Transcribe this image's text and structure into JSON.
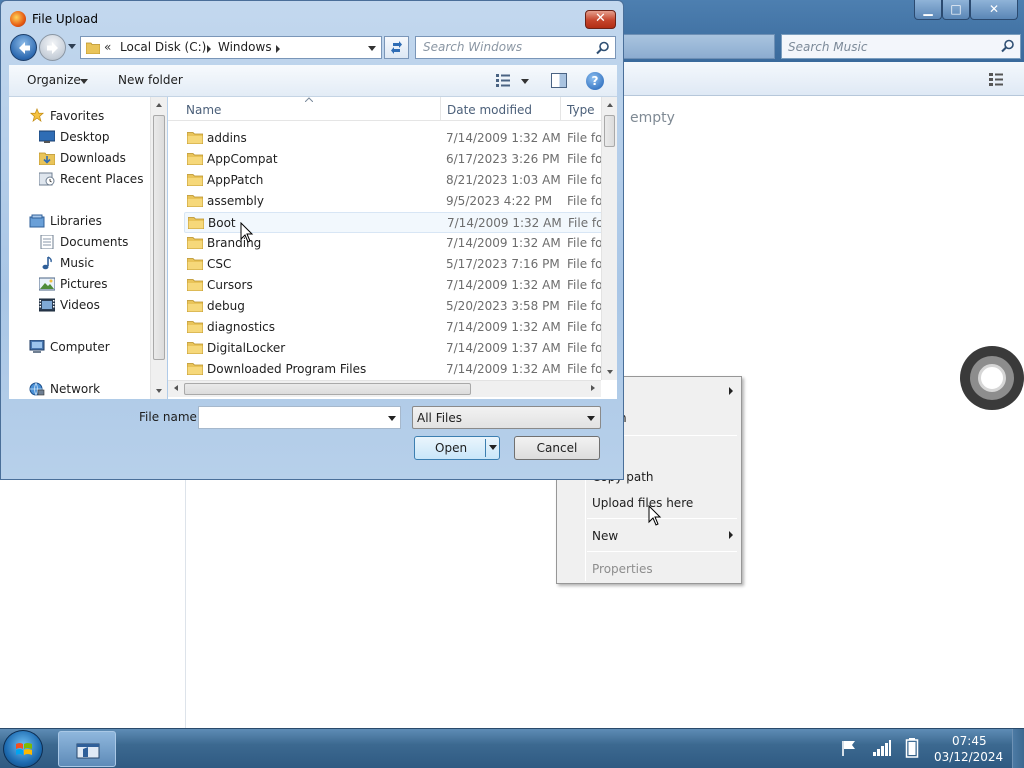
{
  "background_window": {
    "search_placeholder": "Search Music",
    "empty_message": "empty",
    "controls": {
      "minimize": "▁",
      "maximize": "□",
      "close": "✕"
    }
  },
  "context_menu": {
    "items": [
      {
        "label": "",
        "has_submenu": true,
        "enabled": true
      },
      {
        "label": "h",
        "has_submenu": false,
        "enabled": true
      },
      {
        "label": "Copy path",
        "has_submenu": false,
        "enabled": true
      },
      {
        "label": "Upload files here",
        "has_submenu": false,
        "enabled": true
      },
      {
        "label": "New",
        "has_submenu": true,
        "enabled": true
      },
      {
        "label": "Properties",
        "has_submenu": false,
        "enabled": false
      }
    ]
  },
  "dialog": {
    "title": "File Upload",
    "close_label": "✕",
    "address": {
      "chevron": "«",
      "segments": [
        "Local Disk (C:)",
        "Windows"
      ]
    },
    "search_placeholder": "Search Windows",
    "toolbar": {
      "organize": "Organize",
      "new_folder": "New folder",
      "help": "?"
    },
    "nav_pane": {
      "favorites": {
        "label": "Favorites",
        "items": [
          "Desktop",
          "Downloads",
          "Recent Places"
        ]
      },
      "libraries": {
        "label": "Libraries",
        "items": [
          "Documents",
          "Music",
          "Pictures",
          "Videos"
        ]
      },
      "computer": "Computer",
      "network": "Network"
    },
    "columns": {
      "name": "Name",
      "date": "Date modified",
      "type": "Type"
    },
    "files": [
      {
        "name": "addins",
        "date": "7/14/2009 1:32 AM",
        "type": "File folder"
      },
      {
        "name": "AppCompat",
        "date": "6/17/2023 3:26 PM",
        "type": "File folder"
      },
      {
        "name": "AppPatch",
        "date": "8/21/2023 1:03 AM",
        "type": "File folder"
      },
      {
        "name": "assembly",
        "date": "9/5/2023 4:22 PM",
        "type": "File folder"
      },
      {
        "name": "Boot",
        "date": "7/14/2009 1:32 AM",
        "type": "File folder"
      },
      {
        "name": "Branding",
        "date": "7/14/2009 1:32 AM",
        "type": "File folder"
      },
      {
        "name": "CSC",
        "date": "5/17/2023 7:16 PM",
        "type": "File folder"
      },
      {
        "name": "Cursors",
        "date": "7/14/2009 1:32 AM",
        "type": "File folder"
      },
      {
        "name": "debug",
        "date": "5/20/2023 3:58 PM",
        "type": "File folder"
      },
      {
        "name": "diagnostics",
        "date": "7/14/2009 1:32 AM",
        "type": "File folder"
      },
      {
        "name": "DigitalLocker",
        "date": "7/14/2009 1:37 AM",
        "type": "File folder"
      },
      {
        "name": "Downloaded Program Files",
        "date": "7/14/2009 1:32 AM",
        "type": "File folder"
      }
    ],
    "hovered_row": "Boot",
    "file_name_label": "File name:",
    "file_name_value": "",
    "filter": "All Files",
    "open_button": "Open",
    "cancel_button": "Cancel"
  },
  "taskbar": {
    "time": "07:45",
    "date": "03/12/2024"
  },
  "colors": {
    "titlebar": "#3a6a9c",
    "dialog_frame": "#b7d0ea",
    "taskbar": "#3c6990",
    "folder": "#e9c45a"
  }
}
